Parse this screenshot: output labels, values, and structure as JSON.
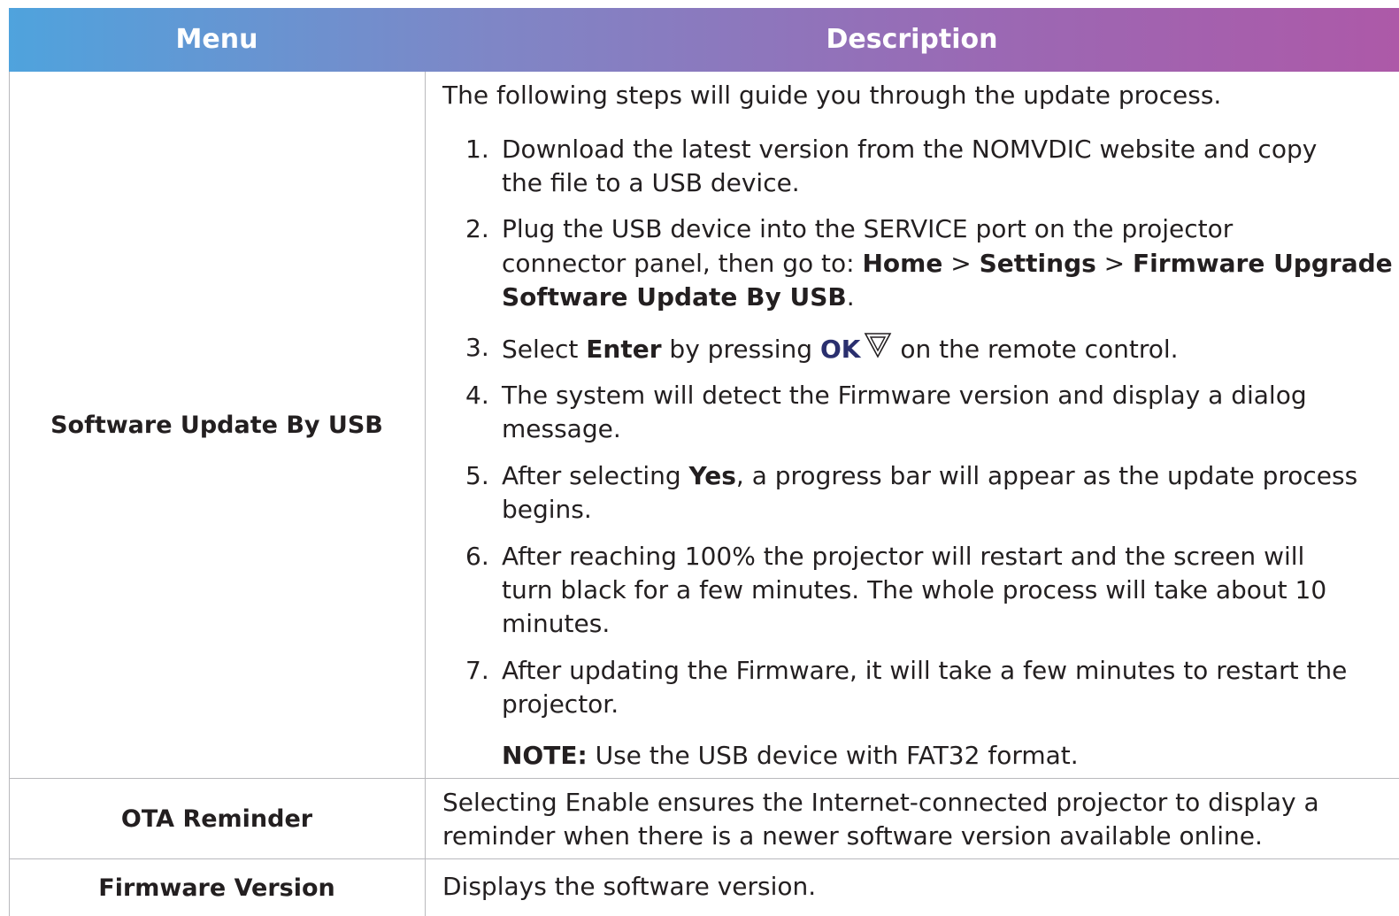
{
  "header": {
    "menu_label": "Menu",
    "description_label": "Description"
  },
  "rows": {
    "usb": {
      "menu": "Software Update By USB",
      "intro": "The following steps will guide you through the update process.",
      "s1": {
        "num": "1.",
        "l1": "Download the latest version from the NOMVDIC website and copy",
        "l2": "the file to a USB device."
      },
      "s2": {
        "num": "2.",
        "l1": "Plug the USB device into the SERVICE port on the projector",
        "l2a": "connector panel, then go to: ",
        "home": "Home",
        "gt1": " > ",
        "settings": "Settings",
        "gt2": " > ",
        "firmware": "Firmware Upgrade",
        "gt3": " >",
        "l3b": "Software Update By USB",
        "l3end": "."
      },
      "s3": {
        "num": "3.",
        "a": "Select ",
        "enter": "Enter",
        "b": " by pressing ",
        "ok": "OK",
        "c": " on the remote control."
      },
      "s4": {
        "num": "4.",
        "l1": "The system will detect the Firmware version and display a dialog",
        "l2": "message."
      },
      "s5": {
        "num": "5.",
        "a": "After selecting ",
        "yes": "Yes",
        "b": ", a progress bar will appear as the update process",
        "l2": "begins."
      },
      "s6": {
        "num": "6.",
        "l1": "After reaching 100% the projector will restart and the screen will",
        "l2": "turn black for a few minutes. The whole process will take about 10",
        "l3": "minutes."
      },
      "s7": {
        "num": "7.",
        "l1": "After updating the Firmware, it will take a few minutes to restart the",
        "l2": "projector."
      },
      "note_label": "NOTE:",
      "note_text": " Use the USB device with FAT32 format."
    },
    "ota": {
      "menu": "OTA Reminder",
      "l1": "Selecting Enable ensures the Internet-connected projector to display a",
      "l2": "reminder when there is a newer software version available online."
    },
    "fw": {
      "menu": "Firmware Version",
      "l1": "Displays the software version."
    }
  },
  "icons": {
    "ok_button": "ok-button-icon"
  }
}
